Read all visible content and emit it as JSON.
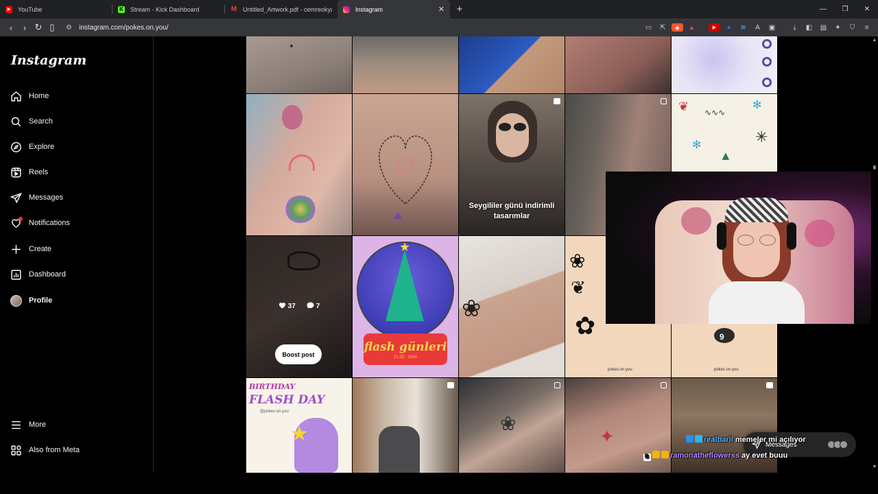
{
  "tabs": [
    {
      "label": "YouTube",
      "favicon_color": "#ff0000"
    },
    {
      "label": "Stream - Kick Dashboard",
      "favicon_color": "#53fc18"
    },
    {
      "label": "Untitled_Artwork.pdf - cemreokyay@",
      "favicon_color": "#ea4335"
    },
    {
      "label": "Instagram",
      "favicon_color": "#d62976",
      "active": true
    }
  ],
  "browser": {
    "url": "instagram.com/pokes.on.you/",
    "new_tab": "+",
    "close_tab": "✕"
  },
  "sidebar": {
    "logo": "Instagram",
    "items": [
      {
        "label": "Home",
        "icon": "home-icon"
      },
      {
        "label": "Search",
        "icon": "search-icon"
      },
      {
        "label": "Explore",
        "icon": "compass-icon"
      },
      {
        "label": "Reels",
        "icon": "reels-icon"
      },
      {
        "label": "Messages",
        "icon": "messages-icon"
      },
      {
        "label": "Notifications",
        "icon": "heart-icon"
      },
      {
        "label": "Create",
        "icon": "plus-icon"
      },
      {
        "label": "Dashboard",
        "icon": "dashboard-icon"
      },
      {
        "label": "Profile",
        "icon": "avatar"
      }
    ],
    "more": "More",
    "also_from_meta": "Also from Meta"
  },
  "grid": {
    "captions": {
      "valentine": "Seygililer günü indirimli tasarımlar",
      "flash": "flash günleri",
      "flash_date": "21-22 . 2024",
      "birthday_1": "BIRTHDAY",
      "birthday_2": "FLASH DAY",
      "birthday_handle": "@pokes.on.you",
      "handle_a": "pokes.on.you",
      "handle_b": "pokes.on.you"
    },
    "hover_post": {
      "likes": "37",
      "comments": "7",
      "boost_label": "Boost post"
    }
  },
  "messages_pill": {
    "label": "Messages"
  },
  "chat": [
    {
      "user": "realbaril",
      "text": "memeler mi açılıyor"
    },
    {
      "user": "ramonatheflowerss",
      "text": "ay evet buuu"
    }
  ],
  "colors": {
    "accent": "#0095f6",
    "notification_dot": "#ff3040",
    "background": "#000000"
  }
}
